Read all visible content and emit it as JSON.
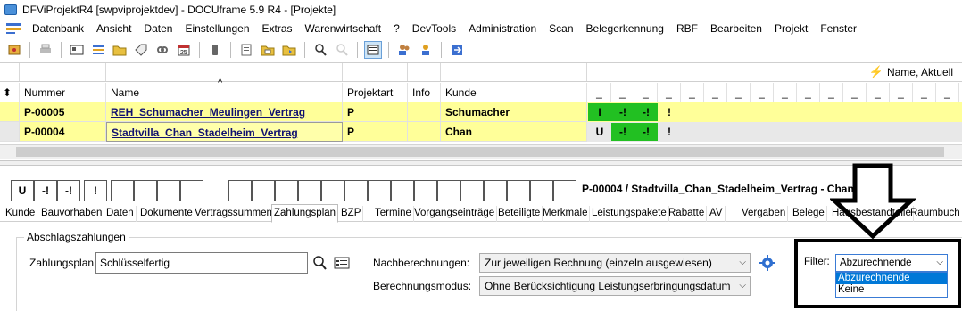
{
  "window": {
    "title": "DFViProjektR4 [swpviprojektdev] - DOCUframe 5.9 R4 - [Projekte]"
  },
  "menu": [
    "Datenbank",
    "Ansicht",
    "Daten",
    "Einstellungen",
    "Extras",
    "Warenwirtschaft",
    "?",
    "DevTools",
    "Administration",
    "Scan",
    "Belegerkennung",
    "RBF",
    "Bearbeiten",
    "Projekt",
    "Fenster"
  ],
  "sort_label": "Name, Aktuell",
  "grid": {
    "headers": [
      "Nummer",
      "Name",
      "Projektart",
      "Info",
      "Kunde"
    ],
    "dash_headers": [
      "_",
      "_",
      "_",
      "_",
      "_",
      "_",
      "_",
      "_",
      "_",
      "_",
      "_",
      "_",
      "_",
      "_",
      "_",
      "_",
      "_",
      "_"
    ],
    "rows": [
      {
        "nummer": "P-00005",
        "name": "REH_Schumacher_Meulingen_Vertrag",
        "projektart": "P",
        "info": "",
        "kunde": "Schumacher",
        "status": [
          "I",
          "-!",
          "-!",
          "!"
        ]
      },
      {
        "nummer": "P-00004",
        "name": "Stadtvilla_Chan_Stadelheim_Vertrag",
        "projektart": "P",
        "info": "",
        "kunde": "Chan",
        "status": [
          "U",
          "-!",
          "-!",
          "!"
        ]
      }
    ]
  },
  "status_boxes": [
    "U",
    "-!",
    "-!",
    "!"
  ],
  "record_label": "P-00004 / Stadtvilla_Chan_Stadelheim_Vertrag - Chan",
  "tabs": [
    "Kunde",
    "Bauvorhaben",
    "Daten",
    "Dokumente",
    "Vertragssummen",
    "Zahlungsplan",
    "BZP",
    "Termine",
    "Vorgangseinträge",
    "Beteiligte",
    "Merkmale",
    "Leistungspakete",
    "Rabatte",
    "AV",
    "Vergaben",
    "Belege",
    "Hausbestandteile",
    "Raumbuch"
  ],
  "active_tab": "Zahlungsplan",
  "panel": {
    "group_title": "Abschlagszahlungen",
    "zahlungsplan_label": "Zahlungsplan:",
    "zahlungsplan_value": "Schlüsselfertig",
    "nachberechnungen_label": "Nachberechnungen:",
    "nachberechnungen_value": "Zur jeweiligen Rechnung (einzeln ausgewiesen)",
    "berechnungsmodus_label": "Berechnungsmodus:",
    "berechnungsmodus_value": "Ohne Berücksichtigung Leistungserbringungsdatum",
    "filter_label": "Filter:",
    "filter_value": "Abzurechnende",
    "filter_options": [
      "Abzurechnende",
      "Keine"
    ]
  },
  "colors": {
    "row_yellow": "#ffff99",
    "row_selected": "#e8e8e8",
    "status_green": "#22c022",
    "selection_blue": "#0078d7"
  }
}
